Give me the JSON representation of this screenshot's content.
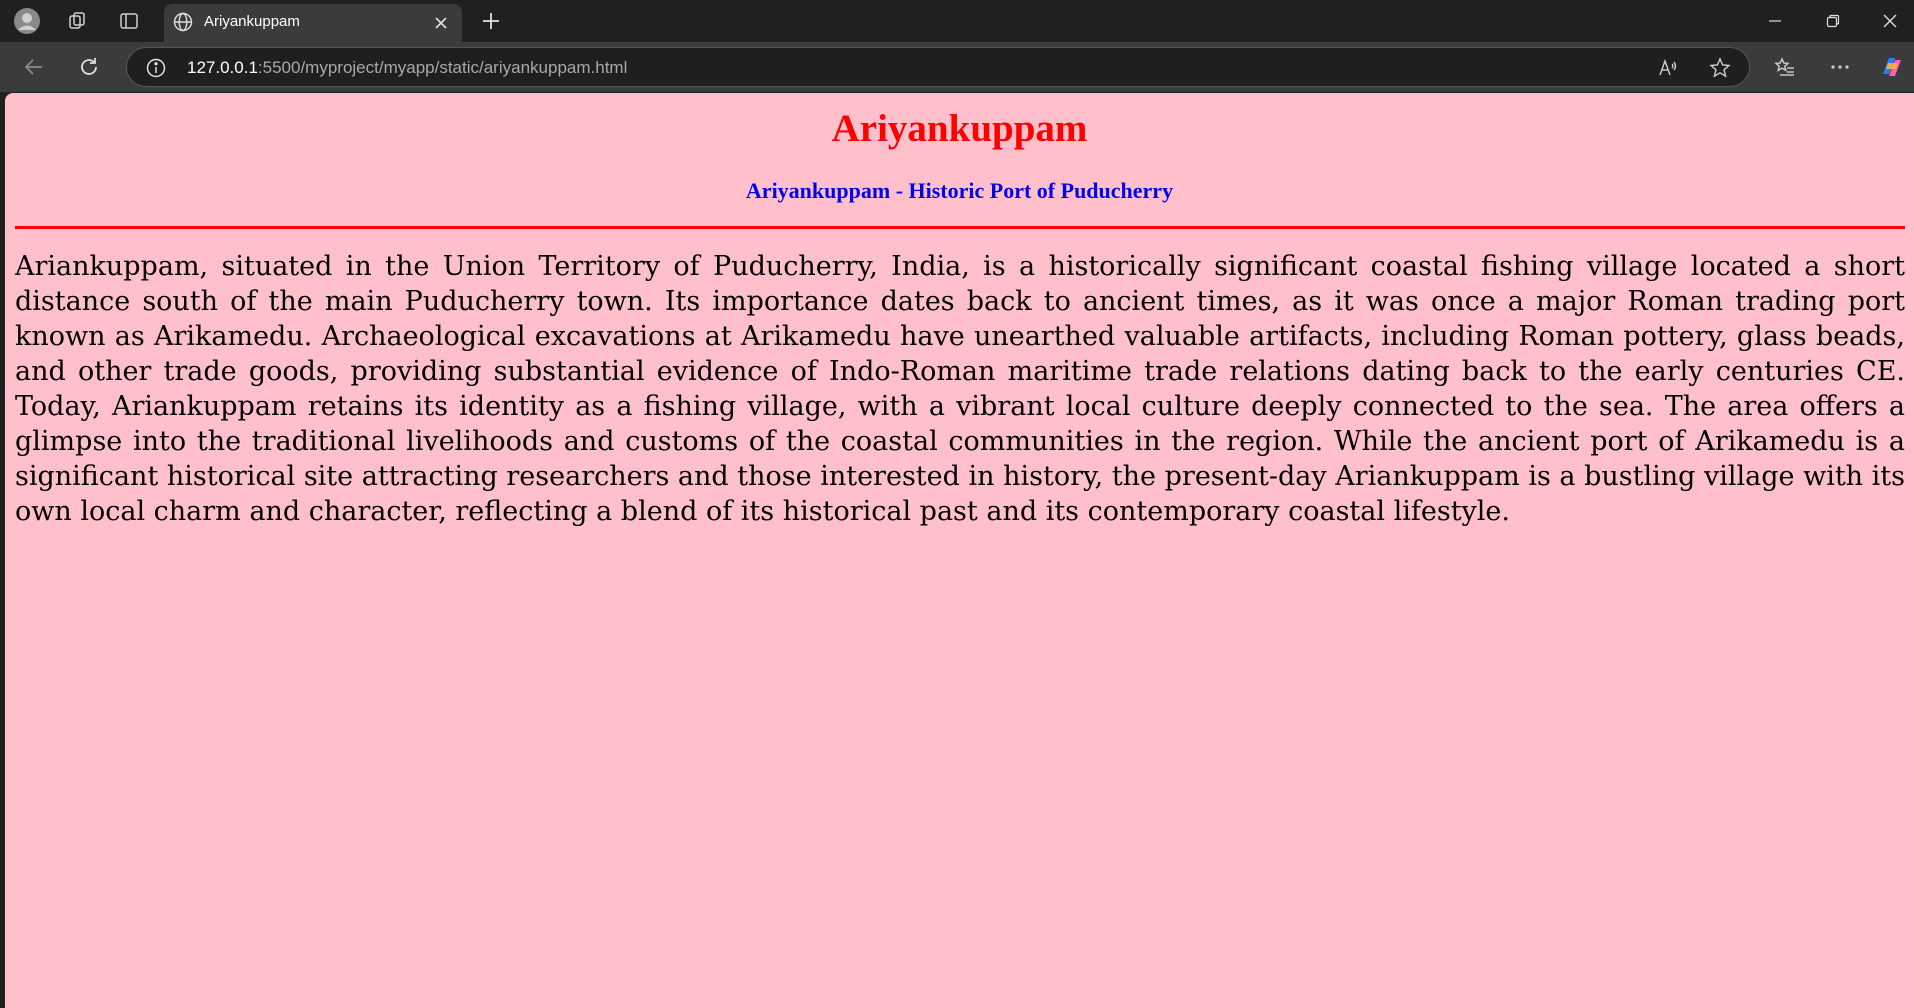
{
  "browser": {
    "tab_title": "Ariyankuppam",
    "url_host": "127.0.0.1",
    "url_rest": ":5500/myproject/myapp/static/ariyankuppam.html"
  },
  "page": {
    "title": "Ariyankuppam",
    "subtitle": "Ariyankuppam - Historic Port of Puducherry",
    "paragraph": "Ariankuppam, situated in the Union Territory of Puducherry, India, is a historically significant coastal fishing village located a short distance south of the main Puducherry town. Its importance dates back to ancient times, as it was once a major Roman trading port known as Arikamedu. Archaeological excavations at Arikamedu have unearthed valuable artifacts, including Roman pottery, glass beads, and other trade goods, providing substantial evidence of Indo-Roman maritime trade relations dating back to the early centuries CE. Today, Ariankuppam retains its identity as a fishing village, with a vibrant local culture deeply connected to the sea. The area offers a glimpse into the traditional livelihoods and customs of the coastal communities in the region. While the ancient port of Arikamedu is a significant historical site attracting researchers and those interested in history, the present-day Ariankuppam is a bustling village with its own local charm and character, reflecting a blend of its historical past and its contemporary coastal lifestyle."
  },
  "colors": {
    "page_bg": "#ffc0cb",
    "title": "#ff0000",
    "subtitle": "#0000ee",
    "rule": "#ff0000"
  }
}
